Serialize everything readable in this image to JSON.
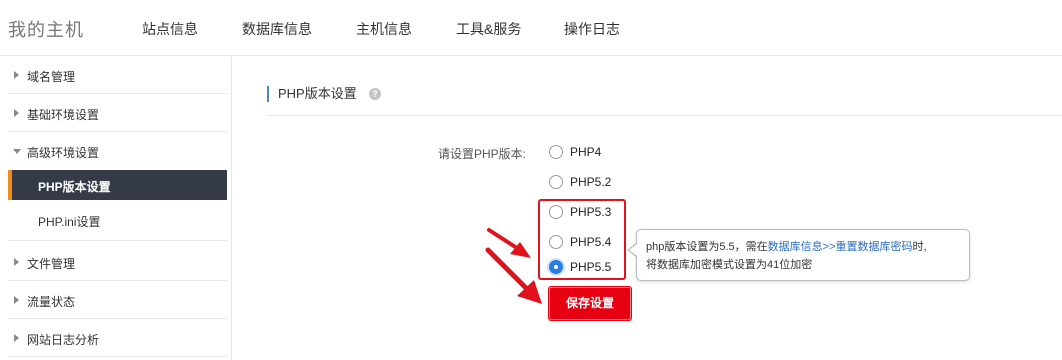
{
  "header": {
    "brand": "我的主机",
    "nav": [
      "站点信息",
      "数据库信息",
      "主机信息",
      "工具&服务",
      "操作日志"
    ]
  },
  "sidebar": {
    "items": [
      {
        "label": "域名管理"
      },
      {
        "label": "基础环境设置"
      },
      {
        "label": "高级环境设置"
      },
      {
        "label": "PHP版本设置"
      },
      {
        "label": "PHP.ini设置"
      },
      {
        "label": "文件管理"
      },
      {
        "label": "流量状态"
      },
      {
        "label": "网站日志分析"
      }
    ]
  },
  "main": {
    "section_title": "PHP版本设置",
    "help_icon": "?",
    "form_label": "请设置PHP版本:",
    "options": [
      "PHP4",
      "PHP5.2",
      "PHP5.3",
      "PHP5.4",
      "PHP5.5"
    ],
    "selected": "PHP5.5",
    "tooltip": {
      "text_before": "php版本设置为5.5，需在",
      "link1": "数据库信息",
      "separator": ">>",
      "link2": "重置数据库密码",
      "text_after": "时,",
      "line2": "将数据库加密模式设置为41位加密"
    },
    "save_label": "保存设置"
  },
  "colors": {
    "accent_red": "#e60012",
    "annotation_red": "#e0121b",
    "sidebar_active_bg": "#353b46",
    "sidebar_active_border": "#f08a1d",
    "link_blue": "#2a6ec0"
  }
}
